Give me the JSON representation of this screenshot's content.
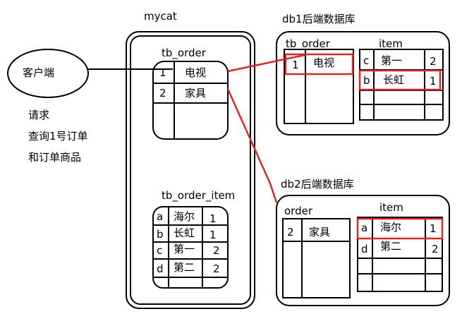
{
  "client": {
    "label": "客户端"
  },
  "request_notes": [
    "请求",
    "查询1号订单",
    "和订单商品"
  ],
  "mycat": {
    "title": "mycat",
    "tb_order": {
      "title": "tb_order",
      "rows": [
        {
          "id": "1",
          "name": "电视"
        },
        {
          "id": "2",
          "name": "家具"
        }
      ]
    },
    "tb_order_item": {
      "title": "tb_order_item",
      "rows": [
        {
          "code": "a",
          "name": "海尔",
          "ref": "1"
        },
        {
          "code": "b",
          "name": "长虹",
          "ref": "1"
        },
        {
          "code": "c",
          "name": "第一",
          "ref": "2"
        },
        {
          "code": "d",
          "name": "第二",
          "ref": "2"
        }
      ]
    }
  },
  "db1": {
    "title": "db1后端数据库",
    "order_table": {
      "title": "tb_order",
      "rows": [
        {
          "id": "1",
          "name": "电视"
        }
      ]
    },
    "item_table": {
      "title": "item",
      "rows": [
        {
          "code": "c",
          "name": "第一",
          "ref": "2"
        },
        {
          "code": "b",
          "name": "长虹",
          "ref": "1"
        }
      ]
    }
  },
  "db2": {
    "title": "db2后端数据库",
    "order_table": {
      "title": "order",
      "rows": [
        {
          "id": "2",
          "name": "家具"
        }
      ]
    },
    "item_table": {
      "title": "item",
      "rows": [
        {
          "code": "a",
          "name": "海尔",
          "ref": "1"
        },
        {
          "code": "d",
          "name": "第二",
          "ref": "2"
        }
      ]
    }
  },
  "colors": {
    "stroke": "#000000",
    "highlight": "#d42a2a",
    "background": "#ffffff"
  }
}
